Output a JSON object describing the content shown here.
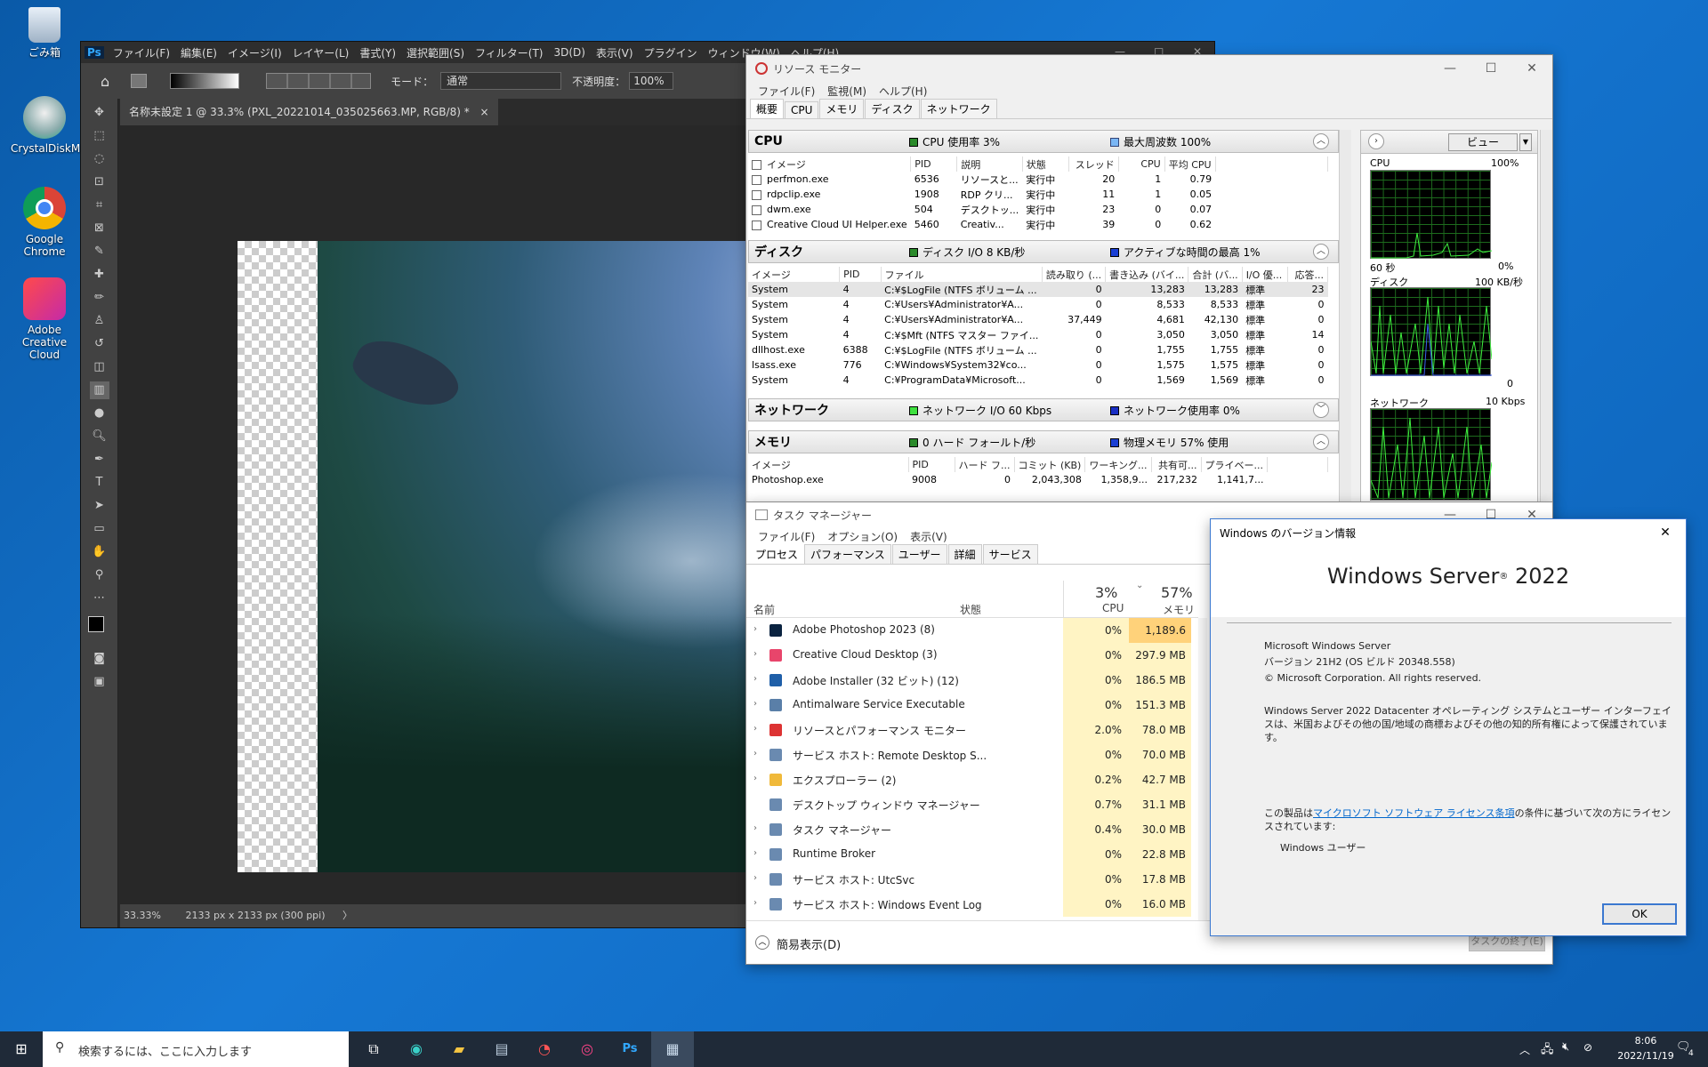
{
  "desktop": {
    "icons": [
      {
        "label": "ごみ箱",
        "icon": "recycle-bin-icon"
      },
      {
        "label": "CrystalDiskMark",
        "icon": "disk-icon"
      },
      {
        "label": "Google Chrome",
        "icon": "chrome-icon"
      },
      {
        "label": "Adobe Creative Cloud",
        "icon": "creative-cloud-icon"
      }
    ]
  },
  "photoshop": {
    "logo": "Ps",
    "menu": [
      "ファイル(F)",
      "編集(E)",
      "イメージ(I)",
      "レイヤー(L)",
      "書式(Y)",
      "選択範囲(S)",
      "フィルター(T)",
      "3D(D)",
      "表示(V)",
      "プラグイン",
      "ウィンドウ(W)",
      "ヘルプ(H)"
    ],
    "options": {
      "mode_label": "モード：",
      "mode_value": "通常",
      "opacity_label": "不透明度：",
      "opacity_value": "100%"
    },
    "doc_tab": "名称未設定 1 @ 33.3% (PXL_20221014_035025663.MP, RGB/8) *",
    "doc_tab_close": "×",
    "status_zoom": "33.33%",
    "status_size": "2133 px x 2133 px (300 ppi)",
    "status_arrow": "〉"
  },
  "resmon": {
    "title": "リソース モニター",
    "menu": [
      "ファイル(F)",
      "監視(M)",
      "ヘルプ(H)"
    ],
    "tabs": [
      "概要",
      "CPU",
      "メモリ",
      "ディスク",
      "ネットワーク"
    ],
    "cpu": {
      "name": "CPU",
      "usage": "CPU 使用率 3%",
      "freq": "最大周波数 100%",
      "headers": [
        "イメージ",
        "PID",
        "説明",
        "状態",
        "スレッド",
        "CPU",
        "平均 CPU"
      ],
      "rows": [
        [
          "perfmon.exe",
          "6536",
          "リソースと...",
          "実行中",
          "20",
          "1",
          "0.79"
        ],
        [
          "rdpclip.exe",
          "1908",
          "RDP クリ...",
          "実行中",
          "11",
          "1",
          "0.05"
        ],
        [
          "dwm.exe",
          "504",
          "デスクトッ...",
          "実行中",
          "23",
          "0",
          "0.07"
        ],
        [
          "Creative Cloud UI Helper.exe",
          "5460",
          "Creativ...",
          "実行中",
          "39",
          "0",
          "0.62"
        ]
      ]
    },
    "disk": {
      "name": "ディスク",
      "io": "ディスク I/O 8 KB/秒",
      "active": "アクティブな時間の最高 1%",
      "headers": [
        "イメージ",
        "PID",
        "ファイル",
        "読み取り (...",
        "書き込み (バイ...",
        "合計 (バ...",
        "I/O 優...",
        "応答..."
      ],
      "rows": [
        [
          "System",
          "4",
          "C:¥$LogFile (NTFS ボリューム ...",
          "0",
          "13,283",
          "13,283",
          "標準",
          "23"
        ],
        [
          "System",
          "4",
          "C:¥Users¥Administrator¥A...",
          "0",
          "8,533",
          "8,533",
          "標準",
          "0"
        ],
        [
          "System",
          "4",
          "C:¥Users¥Administrator¥A...",
          "37,449",
          "4,681",
          "42,130",
          "標準",
          "0"
        ],
        [
          "System",
          "4",
          "C:¥$Mft (NTFS マスター ファイ...",
          "0",
          "3,050",
          "3,050",
          "標準",
          "14"
        ],
        [
          "dllhost.exe",
          "6388",
          "C:¥$LogFile (NTFS ボリューム ...",
          "0",
          "1,755",
          "1,755",
          "標準",
          "0"
        ],
        [
          "lsass.exe",
          "776",
          "C:¥Windows¥System32¥co...",
          "0",
          "1,575",
          "1,575",
          "標準",
          "0"
        ],
        [
          "System",
          "4",
          "C:¥ProgramData¥Microsoft...",
          "0",
          "1,569",
          "1,569",
          "標準",
          "0"
        ]
      ]
    },
    "network": {
      "name": "ネットワーク",
      "io": "ネットワーク I/O 60 Kbps",
      "usage": "ネットワーク使用率 0%"
    },
    "memory": {
      "name": "メモリ",
      "faults": "0 ハード フォールト/秒",
      "physical": "物理メモリ 57% 使用",
      "headers": [
        "イメージ",
        "PID",
        "ハード フ...",
        "コミット (KB)",
        "ワーキング...",
        "共有可...",
        "プライベー..."
      ],
      "rows": [
        [
          "Photoshop.exe",
          "9008",
          "0",
          "2,043,308",
          "1,358,9...",
          "217,232",
          "1,141,7..."
        ]
      ]
    },
    "graphs": {
      "view_button": "ビュー",
      "cpu_label": "CPU",
      "cpu_max": "100%",
      "cpu_time": "60 秒",
      "cpu_min": "0%",
      "disk_label": "ディスク",
      "disk_max": "100 KB/秒",
      "disk_min": "0",
      "net_label": "ネットワーク",
      "net_max": "10 Kbps"
    }
  },
  "taskmgr": {
    "title": "タスク マネージャー",
    "menu": [
      "ファイル(F)",
      "オプション(O)",
      "表示(V)"
    ],
    "tabs": [
      "プロセス",
      "パフォーマンス",
      "ユーザー",
      "詳細",
      "サービス"
    ],
    "col_name": "名前",
    "col_status": "状態",
    "cpu_pct": "3%",
    "cpu_label": "CPU",
    "mem_pct": "57%",
    "mem_label": "メモリ",
    "rows": [
      {
        "name": "Adobe Photoshop 2023 (8)",
        "cpu": "0%",
        "mem": "1,189.6 MB",
        "expand": true
      },
      {
        "name": "Creative Cloud Desktop (3)",
        "cpu": "0%",
        "mem": "297.9 MB",
        "expand": true
      },
      {
        "name": "Adobe Installer (32 ビット) (12)",
        "cpu": "0%",
        "mem": "186.5 MB",
        "expand": true
      },
      {
        "name": "Antimalware Service Executable",
        "cpu": "0%",
        "mem": "151.3 MB",
        "expand": true
      },
      {
        "name": "リソースとパフォーマンス モニター",
        "cpu": "2.0%",
        "mem": "78.0 MB",
        "expand": true
      },
      {
        "name": "サービス ホスト: Remote Desktop S...",
        "cpu": "0%",
        "mem": "70.0 MB",
        "expand": true
      },
      {
        "name": "エクスプローラー (2)",
        "cpu": "0.2%",
        "mem": "42.7 MB",
        "expand": true
      },
      {
        "name": "デスクトップ ウィンドウ マネージャー",
        "cpu": "0.7%",
        "mem": "31.1 MB",
        "expand": false
      },
      {
        "name": "タスク マネージャー",
        "cpu": "0.4%",
        "mem": "30.0 MB",
        "expand": true
      },
      {
        "name": "Runtime Broker",
        "cpu": "0%",
        "mem": "22.8 MB",
        "expand": true
      },
      {
        "name": "サービス ホスト: UtcSvc",
        "cpu": "0%",
        "mem": "17.8 MB",
        "expand": true
      },
      {
        "name": "サービス ホスト: Windows Event Log",
        "cpu": "0%",
        "mem": "16.0 MB",
        "expand": true
      }
    ],
    "fewer_details": "簡易表示(D)",
    "end_task": "タスクの終了(E)"
  },
  "winver": {
    "title": "Windows のバージョン情報",
    "product": "Windows Server",
    "product_mark": "®",
    "product_year": " 2022",
    "line1": "Microsoft Windows Server",
    "line2": "バージョン 21H2 (OS ビルド 20348.558)",
    "line3": "© Microsoft Corporation. All rights reserved.",
    "para": "Windows Server 2022 Datacenter オペレーティング システムとユーザー インターフェイスは、米国およびその他の国/地域の商標およびその他の知的所有権によって保護されています。",
    "license_pre": "この製品は",
    "license_link": "マイクロソフト ソフトウェア ライセンス条項",
    "license_post": "の条件に基づいて次の方にライセンスされています:",
    "user": "Windows ユーザー",
    "ok": "OK"
  },
  "taskbar": {
    "search_placeholder": "検索するには、ここに入力します",
    "time": "8:06",
    "date": "2022/11/19",
    "notif_count": "4"
  }
}
